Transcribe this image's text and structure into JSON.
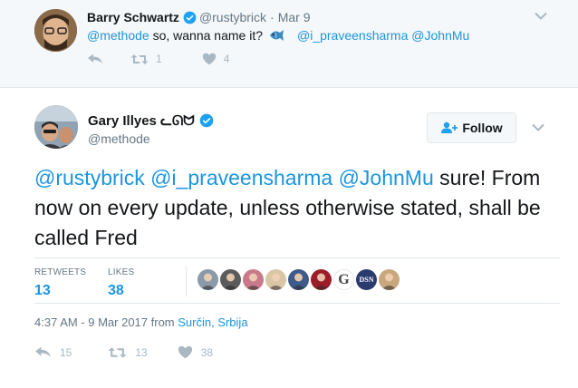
{
  "parent_tweet": {
    "author_name": "Barry Schwartz",
    "handle": "@rustybrick",
    "separator": "·",
    "date": "Mar 9",
    "text_mention_1": "@methode",
    "text_body": " so, wanna name it?",
    "text_mention_2": "@i_praveensharma",
    "text_mention_3": "@JohnMu",
    "reply_count": "",
    "retweet_count": "1",
    "like_count": "4"
  },
  "main_tweet": {
    "author_name": "Gary Illyes ᓚᘏᗢ",
    "handle": "@methode",
    "follow_label": "Follow",
    "text_mentions": "@rustybrick @i_praveensharma @JohnMu",
    "text_body": " sure! From now on every update, unless otherwise stated, shall be called Fred",
    "stats": {
      "retweets_label": "RETWEETS",
      "retweets_value": "13",
      "likes_label": "LIKES",
      "likes_value": "38"
    },
    "likers": [
      {
        "color": "#8a9aa8"
      },
      {
        "color": "#5b5b5b"
      },
      {
        "color": "#c97a8a"
      },
      {
        "color": "#d9c6a5"
      },
      {
        "color": "#3d5a8a"
      },
      {
        "color": "#9b1d2a"
      },
      {
        "color": "#ffffff",
        "label": "G"
      },
      {
        "color": "#2a3b6e",
        "label": "DSN"
      },
      {
        "color": "#c9a77c"
      }
    ],
    "timestamp_text": "4:37 AM - 9 Mar 2017 from ",
    "location": "Surčin, Srbija",
    "reply_count": "15",
    "retweet_count": "13",
    "like_count": "38"
  },
  "colors": {
    "accent": "#1b95e0",
    "muted": "#657786",
    "icon": "#aab8c2"
  }
}
